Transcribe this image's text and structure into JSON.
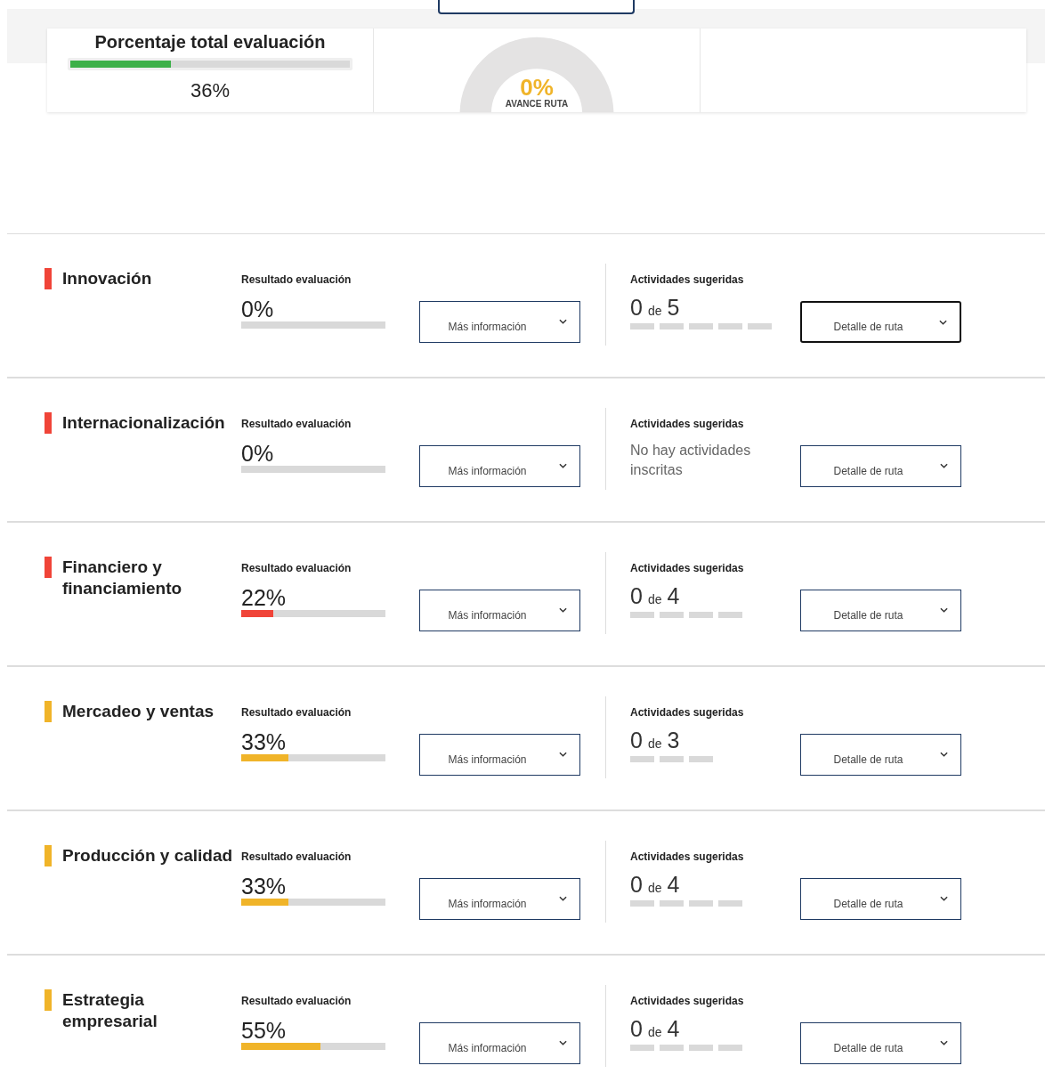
{
  "summary": {
    "title": "Porcentaje total evaluación",
    "level": 0.36,
    "percent": "36%",
    "route_percent": "0%",
    "route_label": "AVANCE RUTA"
  },
  "areas": [
    {
      "name": "Innovación",
      "color": "#f04438",
      "result_label": "Resultado evaluación",
      "percent": "0%",
      "info_button": "Más información",
      "activities_label": "Actividades sugeridas",
      "kind": "count",
      "done": "0",
      "de": "de",
      "total": "5",
      "steps": [
        {
          "done": false
        },
        {
          "done": false
        },
        {
          "done": false
        },
        {
          "done": false
        },
        {
          "done": false
        }
      ],
      "route_button": "Detalle de ruta",
      "focused": true
    },
    {
      "name": "Internacionalización",
      "color": "#f04438",
      "result_label": "Resultado evaluación",
      "percent": "0%",
      "info_button": "Más información",
      "activities_label": "Actividades sugeridas",
      "kind": "empty",
      "message": "No hay actividades inscritas",
      "route_button": "Detalle de ruta",
      "focused": false
    },
    {
      "name": "Financiero y financiamiento",
      "color": "#f04438",
      "result_label": "Resultado evaluación",
      "percent": "22%",
      "level": 0.22,
      "info_button": "Más información",
      "activities_label": "Actividades sugeridas",
      "kind": "count",
      "done": "0",
      "de": "de",
      "total": "4",
      "steps": [
        {
          "done": false
        },
        {
          "done": false
        },
        {
          "done": false
        },
        {
          "done": false
        }
      ],
      "route_button": "Detalle de ruta",
      "focused": false
    },
    {
      "name": "Mercadeo y ventas",
      "color": "#f0b429",
      "result_label": "Resultado evaluación",
      "percent": "33%",
      "level": 0.33,
      "info_button": "Más información",
      "activities_label": "Actividades sugeridas",
      "kind": "count",
      "done": "0",
      "de": "de",
      "total": "3",
      "steps": [
        {
          "done": false
        },
        {
          "done": false
        },
        {
          "done": false
        }
      ],
      "route_button": "Detalle de ruta",
      "focused": false
    },
    {
      "name": "Producción y calidad",
      "color": "#f0b429",
      "result_label": "Resultado evaluación",
      "percent": "33%",
      "level": 0.33,
      "info_button": "Más información",
      "activities_label": "Actividades sugeridas",
      "kind": "count",
      "done": "0",
      "de": "de",
      "total": "4",
      "steps": [
        {
          "done": false
        },
        {
          "done": false
        },
        {
          "done": false
        },
        {
          "done": false
        }
      ],
      "route_button": "Detalle de ruta",
      "focused": false
    },
    {
      "name": "Estrategia empresarial",
      "color": "#f0b429",
      "result_label": "Resultado evaluación",
      "percent": "55%",
      "level": 0.55,
      "info_button": "Más información",
      "activities_label": "Actividades sugeridas",
      "kind": "count",
      "done": "0",
      "de": "de",
      "total": "4",
      "steps": [
        {
          "done": false
        },
        {
          "done": false
        },
        {
          "done": false
        },
        {
          "done": false
        }
      ],
      "route_button": "Detalle de ruta",
      "focused": false
    }
  ]
}
